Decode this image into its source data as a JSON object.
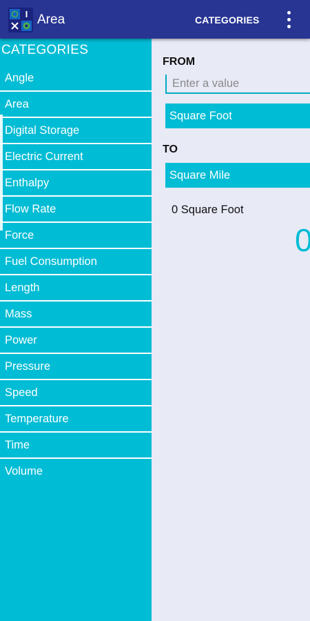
{
  "app_bar": {
    "title": "Area",
    "logo_icon": "unit-converter-logo-icon",
    "categories_action": "CATEGORIES",
    "overflow_icon": "more-vert-icon",
    "background_color": "#283593"
  },
  "drawer": {
    "header": "CATEGORIES",
    "background_color": "#00bcd4",
    "items": [
      {
        "label": "Angle"
      },
      {
        "label": "Area"
      },
      {
        "label": "Digital Storage"
      },
      {
        "label": "Electric Current"
      },
      {
        "label": "Enthalpy"
      },
      {
        "label": "Flow Rate"
      },
      {
        "label": "Force"
      },
      {
        "label": "Fuel Consumption"
      },
      {
        "label": "Length"
      },
      {
        "label": "Mass"
      },
      {
        "label": "Power"
      },
      {
        "label": "Pressure"
      },
      {
        "label": "Speed"
      },
      {
        "label": "Temperature"
      },
      {
        "label": "Time"
      },
      {
        "label": "Volume"
      }
    ]
  },
  "converter": {
    "from_label": "FROM",
    "input_value": "",
    "input_placeholder": "Enter a value",
    "from_unit": "Square Foot",
    "to_label": "TO",
    "to_unit": "Square Mile",
    "result_text": "0 Square Foot",
    "big_result": "0",
    "accent_color": "#00bcd4"
  }
}
